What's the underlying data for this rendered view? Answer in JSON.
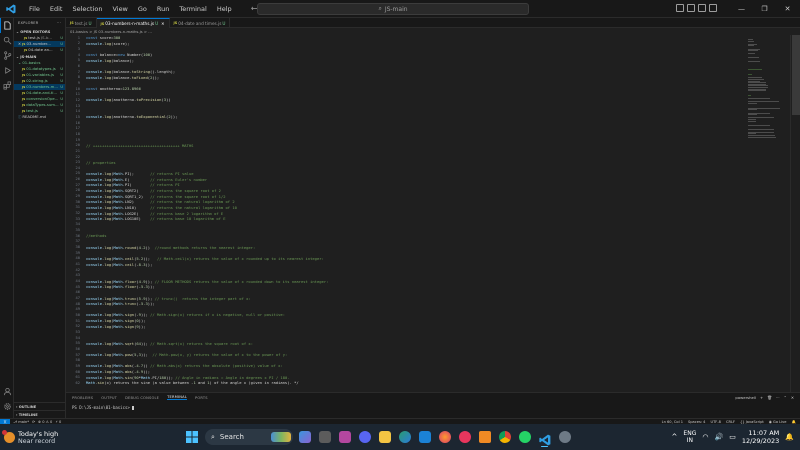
{
  "menu": [
    "File",
    "Edit",
    "Selection",
    "View",
    "Go",
    "Run",
    "Terminal",
    "Help"
  ],
  "window": {
    "search": "JS-main"
  },
  "sidebar": {
    "title": "EXPLORER",
    "open_editors_label": "OPEN EDITORS",
    "open_editors": [
      {
        "name": "test.js",
        "path": "JS-b...",
        "mark": "U"
      },
      {
        "name": "03-number...",
        "path": "",
        "mark": "U"
      },
      {
        "name": "04-date an...",
        "path": "",
        "mark": "U"
      }
    ],
    "root_label": "JS-MAIN",
    "folder": "01-basics",
    "files": [
      {
        "name": "01-datatypes.js",
        "mark": "U"
      },
      {
        "name": "01-variables.js",
        "mark": "U"
      },
      {
        "name": "02-string.js",
        "mark": "U"
      },
      {
        "name": "03-numbers-m...",
        "mark": "U"
      },
      {
        "name": "04-date-and-ti...",
        "mark": "U"
      },
      {
        "name": "conversionOpe...",
        "mark": "U"
      },
      {
        "name": "dataTypes-sum...",
        "mark": "U"
      },
      {
        "name": "test.js",
        "mark": "U"
      },
      {
        "name": "README.md",
        "mark": ""
      }
    ],
    "outline_label": "OUTLINE",
    "timeline_label": "TIMELINE"
  },
  "tabs": [
    {
      "name": "test.js",
      "mark": "U",
      "active": false
    },
    {
      "name": "03-numbers-n-maths.js",
      "mark": "U",
      "active": true
    },
    {
      "name": "04-date and times.js",
      "mark": "U",
      "active": false
    }
  ],
  "breadcrumb": "01-basics > JS 03-numbers-n-maths.js > ...",
  "code": [
    {
      "n": 1,
      "t": "const score=300"
    },
    {
      "n": 2,
      "t": "console.log(score);"
    },
    {
      "n": 3,
      "t": ""
    },
    {
      "n": 4,
      "t": "const balance=new Number(100)"
    },
    {
      "n": 5,
      "t": "console.log(balance);"
    },
    {
      "n": 6,
      "t": ""
    },
    {
      "n": 7,
      "t": "console.log(balance.toString().length);"
    },
    {
      "n": 8,
      "t": "console.log(balance.toFixed(2));"
    },
    {
      "n": 9,
      "t": ""
    },
    {
      "n": 10,
      "t": "const anotherno=123.8966"
    },
    {
      "n": 11,
      "t": ""
    },
    {
      "n": 12,
      "t": "console.log(anotherno.toPrecision(3))"
    },
    {
      "n": 13,
      "t": ""
    },
    {
      "n": 14,
      "t": ""
    },
    {
      "n": 15,
      "t": "console.log(anotherno.toExponential(2));"
    },
    {
      "n": 16,
      "t": ""
    },
    {
      "n": 17,
      "t": ""
    },
    {
      "n": 18,
      "t": ""
    },
    {
      "n": 19,
      "t": ""
    },
    {
      "n": 20,
      "t": "// ++++++++++++++++++++++++++++++++++++++ MATHS"
    },
    {
      "n": 21,
      "t": ""
    },
    {
      "n": 22,
      "t": ""
    },
    {
      "n": 23,
      "t": "// properties"
    },
    {
      "n": 24,
      "t": ""
    },
    {
      "n": 25,
      "t": "console.log(Math.PI);       // returns PI value"
    },
    {
      "n": 26,
      "t": "console.log(Math.E)         // returns Euler's number"
    },
    {
      "n": 27,
      "t": "console.log(Math.PI)        // returns PI"
    },
    {
      "n": 28,
      "t": "console.log(Math.SQRT2)     // returns the square root of 2"
    },
    {
      "n": 29,
      "t": "console.log(Math.SQRT1_2)   // returns the square root of 1/2"
    },
    {
      "n": 30,
      "t": "console.log(Math.LN2)       // returns the natural logarithm of 2"
    },
    {
      "n": 31,
      "t": "console.log(Math.LN10)      // returns the natural logarithm of 10"
    },
    {
      "n": 32,
      "t": "console.log(Math.LOG2E)     // returns base 2 logarithm of E"
    },
    {
      "n": 33,
      "t": "console.log(Math.LOG10E)    // returns base 10 logarithm of E"
    },
    {
      "n": 34,
      "t": ""
    },
    {
      "n": 35,
      "t": ""
    },
    {
      "n": 36,
      "t": "//methods"
    },
    {
      "n": 37,
      "t": ""
    },
    {
      "n": 38,
      "t": "console.log(Math.round(4.2))  //round methods returns the nearest integer:"
    },
    {
      "n": 39,
      "t": ""
    },
    {
      "n": 40,
      "t": "console.log(Math.ceil(5.2));   // Math.ceil(x) returns the value of x rounded up to its nearest integer:"
    },
    {
      "n": 41,
      "t": "console.log(Math.ceil(-8.3));"
    },
    {
      "n": 42,
      "t": ""
    },
    {
      "n": 43,
      "t": ""
    },
    {
      "n": 44,
      "t": "console.log(Math.floor(4.9)); // FLOOR METHODS returns the value of x rounded down to its nearest integer:"
    },
    {
      "n": 45,
      "t": "console.log(Math.floor(-5.3));"
    },
    {
      "n": 46,
      "t": ""
    },
    {
      "n": 47,
      "t": "console.log(Math.trunc(5.9)); // trunc()  returns the integer part of x:"
    },
    {
      "n": 48,
      "t": "console.log(Math.trunc(-5.3));"
    },
    {
      "n": 49,
      "t": ""
    },
    {
      "n": 50,
      "t": "console.log(Math.sign(-9)); // Math.sign(x) returns if x is negative, null or positive:"
    },
    {
      "n": 51,
      "t": "console.log(Math.sign(0));"
    },
    {
      "n": 52,
      "t": "console.log(Math.sign(9));"
    },
    {
      "n": 53,
      "t": ""
    },
    {
      "n": 54,
      "t": ""
    },
    {
      "n": 55,
      "t": "console.log(Math.sqrt(64)); // Math.sqrt(x) returns the square root of x:"
    },
    {
      "n": 56,
      "t": ""
    },
    {
      "n": 57,
      "t": "console.log(Math.pow(5,3));  // Math.pow(x, y) returns the value of x to the power of y:"
    },
    {
      "n": 58,
      "t": ""
    },
    {
      "n": 59,
      "t": "console.log(Math.abs(-4.7)) // Math.abs(x) returns the absolute (positive) value of x:"
    },
    {
      "n": 60,
      "t": "console.log(Math.abs(-4.9));"
    },
    {
      "n": 61,
      "t": "console.log(Math.sin(90*Math.PI/180)); // Angle in radians = Angle in degrees x PI / 180."
    },
    {
      "n": 62,
      "t": "Math.sin(x) returns the sine (a value between -1 and 1) of the angle x (given in radians). */"
    }
  ],
  "panel": {
    "tabs": [
      "PROBLEMS",
      "OUTPUT",
      "DEBUG CONSOLE",
      "TERMINAL",
      "PORTS"
    ],
    "active_tab": "TERMINAL",
    "shell": "powershell",
    "prompt": "PS D:\\JS-main\\01-basics> "
  },
  "status": {
    "branch": "main*",
    "sync": "⟳",
    "errors": "⊗ 0 ⚠ 0",
    "ports": "⚡ 0",
    "position": "Ln 60, Col 1",
    "spaces": "Spaces: 4",
    "encoding": "UTF-8",
    "eol": "CRLF",
    "language": "{} JavaScript",
    "live": "Go Live"
  },
  "taskbar": {
    "weather_title": "Today's high",
    "weather_sub": "Near record",
    "search": "Search",
    "lang_1": "ENG",
    "lang_2": "IN",
    "time": "11:07 AM",
    "date": "12/29/2023"
  }
}
